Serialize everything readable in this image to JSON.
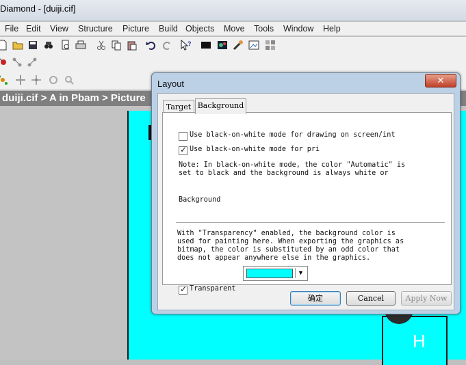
{
  "window": {
    "title": "Diamond - [duiji.cif]"
  },
  "menu": [
    "File",
    "Edit",
    "View",
    "Structure",
    "Picture",
    "Build",
    "Objects",
    "Move",
    "Tools",
    "Window",
    "Help"
  ],
  "breadcrumb": "duiji.cif > A in Pbam > Picture",
  "canvas": {
    "atom_label": "H",
    "background": "#00ffff"
  },
  "dialog": {
    "title": "Layout",
    "close_glyph": "✕",
    "tabs": [
      "Target",
      "Background"
    ],
    "active_tab": "Background",
    "screen_bw": {
      "label": "Use black-on-white mode for drawing on screen/int",
      "checked": false
    },
    "print_bw": {
      "label": "Use black-on-white mode for pri",
      "checked": true
    },
    "note_line1": "Note: In black-on-white mode, the color \"Automatic\" is",
    "note_line2": "set to black and the background is always white or",
    "background_label": "Background",
    "background_color": "#00ffff",
    "transparent": {
      "label": "Transparent",
      "checked": true
    },
    "trans_line1": "With \"Transparency\" enabled, the background color is",
    "trans_line2": "used for painting here. When exporting the graphics as",
    "trans_line3": "bitmap, the color is substituted by an odd color that",
    "trans_line4": "does not appear anywhere else in the graphics.",
    "buttons": {
      "ok": "确定",
      "cancel": "Cancel",
      "apply": "Apply Now"
    }
  }
}
